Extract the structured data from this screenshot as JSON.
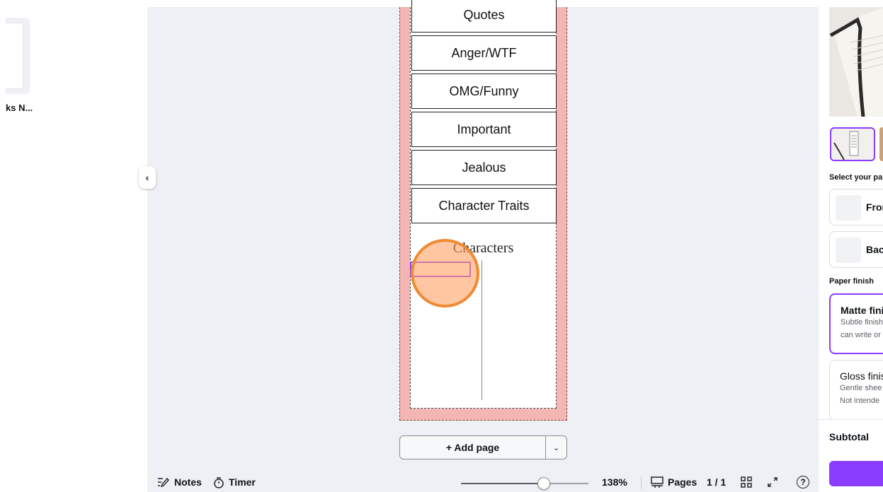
{
  "left_panel": {
    "thumbnail_label": "ks N..."
  },
  "canvas": {
    "tabs": [
      "Quotes",
      "Anger/WTF",
      "OMG/Funny",
      "Important",
      "Jealous",
      "Character Traits"
    ],
    "characters_heading": "Characters",
    "page_color": "#f4b6b3",
    "add_page_label": "+ Add page"
  },
  "bottom_bar": {
    "notes_label": "Notes",
    "timer_label": "Timer",
    "zoom_percent": 0.65,
    "zoom_label": "138%",
    "pages_label": "Pages",
    "page_count": "1 / 1",
    "help_label": "?"
  },
  "right_panel": {
    "select_label": "Select your pa",
    "front_label": "Fron",
    "back_label": "Bac",
    "paper_finish_label": "Paper finish",
    "matte_title": "Matte finis",
    "matte_sub1": "Subtle finish",
    "matte_sub2": "can write or",
    "gloss_title": "Gloss finis",
    "gloss_sub1": "Gentle shee",
    "gloss_sub2": "Not intende",
    "subtotal_label": "Subtotal",
    "accent_color": "#8b3dff"
  }
}
